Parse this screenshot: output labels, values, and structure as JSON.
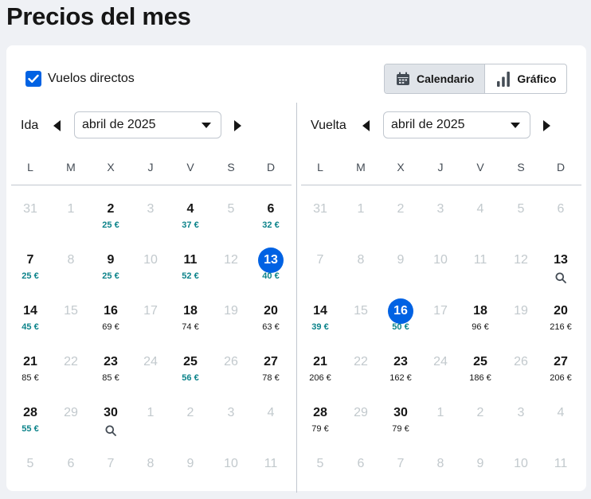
{
  "page": {
    "title": "Precios del mes"
  },
  "filters": {
    "direct_label": "Vuelos directos",
    "direct_checked": true
  },
  "view_toggle": {
    "calendar_label": "Calendario",
    "chart_label": "Gráfico",
    "active": "calendar"
  },
  "colors": {
    "accent": "#0062e3",
    "low_price": "#0c838a",
    "divider": "#c1c7cf",
    "disabled_text": "#c2c9cd"
  },
  "weekdays": [
    "L",
    "M",
    "X",
    "J",
    "V",
    "S",
    "D"
  ],
  "outbound": {
    "label": "Ida",
    "month": "abril de 2025",
    "weeks": [
      [
        {
          "d": "31",
          "off": true
        },
        {
          "d": "1",
          "off": true
        },
        {
          "d": "2",
          "p": "25 €",
          "low": true
        },
        {
          "d": "3",
          "off": true
        },
        {
          "d": "4",
          "p": "37 €",
          "low": true
        },
        {
          "d": "5",
          "off": true
        },
        {
          "d": "6",
          "p": "32 €",
          "low": true
        }
      ],
      [
        {
          "d": "7",
          "p": "25 €",
          "low": true
        },
        {
          "d": "8",
          "off": true
        },
        {
          "d": "9",
          "p": "25 €",
          "low": true
        },
        {
          "d": "10",
          "off": true
        },
        {
          "d": "11",
          "p": "52 €",
          "low": true
        },
        {
          "d": "12",
          "off": true
        },
        {
          "d": "13",
          "p": "40 €",
          "low": true,
          "sel": true
        }
      ],
      [
        {
          "d": "14",
          "p": "45 €",
          "low": true
        },
        {
          "d": "15",
          "off": true
        },
        {
          "d": "16",
          "p": "69 €"
        },
        {
          "d": "17",
          "off": true
        },
        {
          "d": "18",
          "p": "74 €"
        },
        {
          "d": "19",
          "off": true
        },
        {
          "d": "20",
          "p": "63 €"
        }
      ],
      [
        {
          "d": "21",
          "p": "85 €"
        },
        {
          "d": "22",
          "off": true
        },
        {
          "d": "23",
          "p": "85 €"
        },
        {
          "d": "24",
          "off": true
        },
        {
          "d": "25",
          "p": "56 €",
          "low": true
        },
        {
          "d": "26",
          "off": true
        },
        {
          "d": "27",
          "p": "78 €"
        }
      ],
      [
        {
          "d": "28",
          "p": "55 €",
          "low": true
        },
        {
          "d": "29",
          "off": true
        },
        {
          "d": "30",
          "search": true
        },
        {
          "d": "1",
          "off": true
        },
        {
          "d": "2",
          "off": true
        },
        {
          "d": "3",
          "off": true
        },
        {
          "d": "4",
          "off": true
        }
      ],
      [
        {
          "d": "5",
          "off": true
        },
        {
          "d": "6",
          "off": true
        },
        {
          "d": "7",
          "off": true
        },
        {
          "d": "8",
          "off": true
        },
        {
          "d": "9",
          "off": true
        },
        {
          "d": "10",
          "off": true
        },
        {
          "d": "11",
          "off": true
        }
      ]
    ]
  },
  "return": {
    "label": "Vuelta",
    "month": "abril de 2025",
    "weeks": [
      [
        {
          "d": "31",
          "off": true
        },
        {
          "d": "1",
          "off": true
        },
        {
          "d": "2",
          "off": true
        },
        {
          "d": "3",
          "off": true
        },
        {
          "d": "4",
          "off": true
        },
        {
          "d": "5",
          "off": true
        },
        {
          "d": "6",
          "off": true
        }
      ],
      [
        {
          "d": "7",
          "off": true
        },
        {
          "d": "8",
          "off": true
        },
        {
          "d": "9",
          "off": true
        },
        {
          "d": "10",
          "off": true
        },
        {
          "d": "11",
          "off": true
        },
        {
          "d": "12",
          "off": true
        },
        {
          "d": "13",
          "search": true
        }
      ],
      [
        {
          "d": "14",
          "p": "39 €",
          "low": true
        },
        {
          "d": "15",
          "off": true
        },
        {
          "d": "16",
          "p": "50 €",
          "low": true,
          "sel": true
        },
        {
          "d": "17",
          "off": true
        },
        {
          "d": "18",
          "p": "96 €"
        },
        {
          "d": "19",
          "off": true
        },
        {
          "d": "20",
          "p": "216 €"
        }
      ],
      [
        {
          "d": "21",
          "p": "206 €"
        },
        {
          "d": "22",
          "off": true
        },
        {
          "d": "23",
          "p": "162 €"
        },
        {
          "d": "24",
          "off": true
        },
        {
          "d": "25",
          "p": "186 €"
        },
        {
          "d": "26",
          "off": true
        },
        {
          "d": "27",
          "p": "206 €"
        }
      ],
      [
        {
          "d": "28",
          "p": "79 €"
        },
        {
          "d": "29",
          "off": true
        },
        {
          "d": "30",
          "p": "79 €"
        },
        {
          "d": "1",
          "off": true
        },
        {
          "d": "2",
          "off": true
        },
        {
          "d": "3",
          "off": true
        },
        {
          "d": "4",
          "off": true
        }
      ],
      [
        {
          "d": "5",
          "off": true
        },
        {
          "d": "6",
          "off": true
        },
        {
          "d": "7",
          "off": true
        },
        {
          "d": "8",
          "off": true
        },
        {
          "d": "9",
          "off": true
        },
        {
          "d": "10",
          "off": true
        },
        {
          "d": "11",
          "off": true
        }
      ]
    ]
  }
}
